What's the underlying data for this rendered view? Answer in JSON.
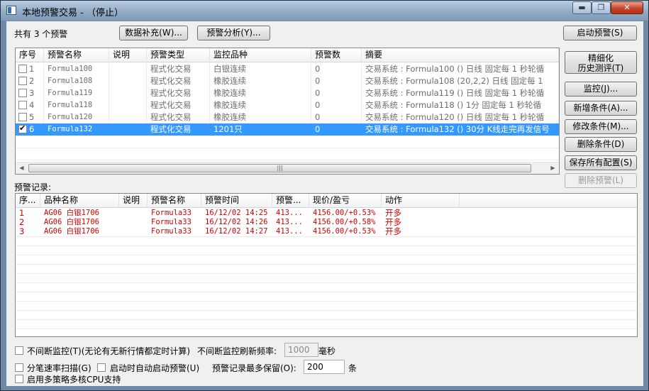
{
  "window": {
    "title": "本地预警交易  - （停止）"
  },
  "titlebar": {
    "min": "▬",
    "max": "❐",
    "close": "✕"
  },
  "header": {
    "count_text": "共有 3 个预警"
  },
  "toolbar": {
    "data_fill": "数据补充(W)...",
    "warn_analysis": "预警分析(Y)...",
    "start_warn": "启动预警(S)"
  },
  "side_buttons": {
    "refine_line1": "精细化",
    "refine_line2": "历史测评(T)",
    "monitor": "监控(J)...",
    "add_cond": "新增条件(A)...",
    "edit_cond": "修改条件(M)...",
    "delete_cond": "删除条件(D)",
    "save_all": "保存所有配置(S)",
    "delete_warn": "删除预警(L)"
  },
  "conditions_table": {
    "columns": [
      "序号",
      "预警名称",
      "说明",
      "预警类型",
      "监控品种",
      "预警数",
      "摘要"
    ],
    "rows": [
      {
        "checked": false,
        "no": "1",
        "name": "Formula100",
        "desc": "",
        "type": "程式化交易",
        "target": "白银连续",
        "count": "0",
        "summary": "交易系统 : Formula100 () 日线 固定每 1 秒轮循"
      },
      {
        "checked": false,
        "no": "2",
        "name": "Formula108",
        "desc": "",
        "type": "程式化交易",
        "target": "橡胶连续",
        "count": "0",
        "summary": "交易系统 : Formula108 (20,2,2) 日线 固定每 1"
      },
      {
        "checked": false,
        "no": "3",
        "name": "Formula119",
        "desc": "",
        "type": "程式化交易",
        "target": "橡胶连续",
        "count": "0",
        "summary": "交易系统 : Formula119 () 日线 固定每 1 秒轮循"
      },
      {
        "checked": false,
        "no": "4",
        "name": "Formula118",
        "desc": "",
        "type": "程式化交易",
        "target": "橡胶连续",
        "count": "0",
        "summary": "交易系统 : Formula118 () 1分 固定每 1 秒轮循"
      },
      {
        "checked": false,
        "no": "5",
        "name": "Formula120",
        "desc": "",
        "type": "程式化交易",
        "target": "橡胶连续",
        "count": "0",
        "summary": "交易系统 : Formula120 () 日线 固定每 1 秒轮循"
      },
      {
        "checked": true,
        "no": "6",
        "name": "Formula132",
        "desc": "",
        "type": "程式化交易",
        "target": "1201只",
        "count": "0",
        "summary": "交易系统 : Formula132 () 30分 K线走完再发信号"
      }
    ]
  },
  "records": {
    "label": "预警记录:",
    "columns": [
      "序...",
      "品种名称",
      "说明",
      "预警名称",
      "预警时间",
      "预警...",
      "现价/盈亏",
      "动作"
    ],
    "rows": [
      {
        "no": "1",
        "symbol": "AG06 白银1706",
        "desc": "",
        "name": "Formula33",
        "time": "16/12/02 14:25",
        "warn": "413...",
        "price": "4156.00/+0.53%",
        "action": "开多"
      },
      {
        "no": "2",
        "symbol": "AG06 白银1706",
        "desc": "",
        "name": "Formula33",
        "time": "16/12/02 14:26",
        "warn": "413...",
        "price": "4156.00/+0.58%",
        "action": "开多"
      },
      {
        "no": "3",
        "symbol": "AG06 白银1706",
        "desc": "",
        "name": "Formula33",
        "time": "16/12/02 14:27",
        "warn": "413...",
        "price": "4156.00/+0.53%",
        "action": "开多"
      }
    ]
  },
  "options": {
    "continuous_monitor": "不间断监控(T)(无论有无新行情都定时计算)",
    "refresh_label": "不间断监控刷新频率:",
    "refresh_value": "1000",
    "refresh_unit": "毫秒",
    "tick_scan": "分笔速率扫描(G)",
    "auto_start": "启动时自动启动预警(U)",
    "keep_label": "预警记录最多保留(O):",
    "keep_value": "200",
    "keep_unit": "条",
    "multi_cpu": "启用多策略多核CPU支持"
  },
  "scrollbar": {
    "left": "◀",
    "right": "▶",
    "grip": "|||"
  },
  "colors": {
    "selection": "#3399ff",
    "record_text": "#d10000"
  }
}
